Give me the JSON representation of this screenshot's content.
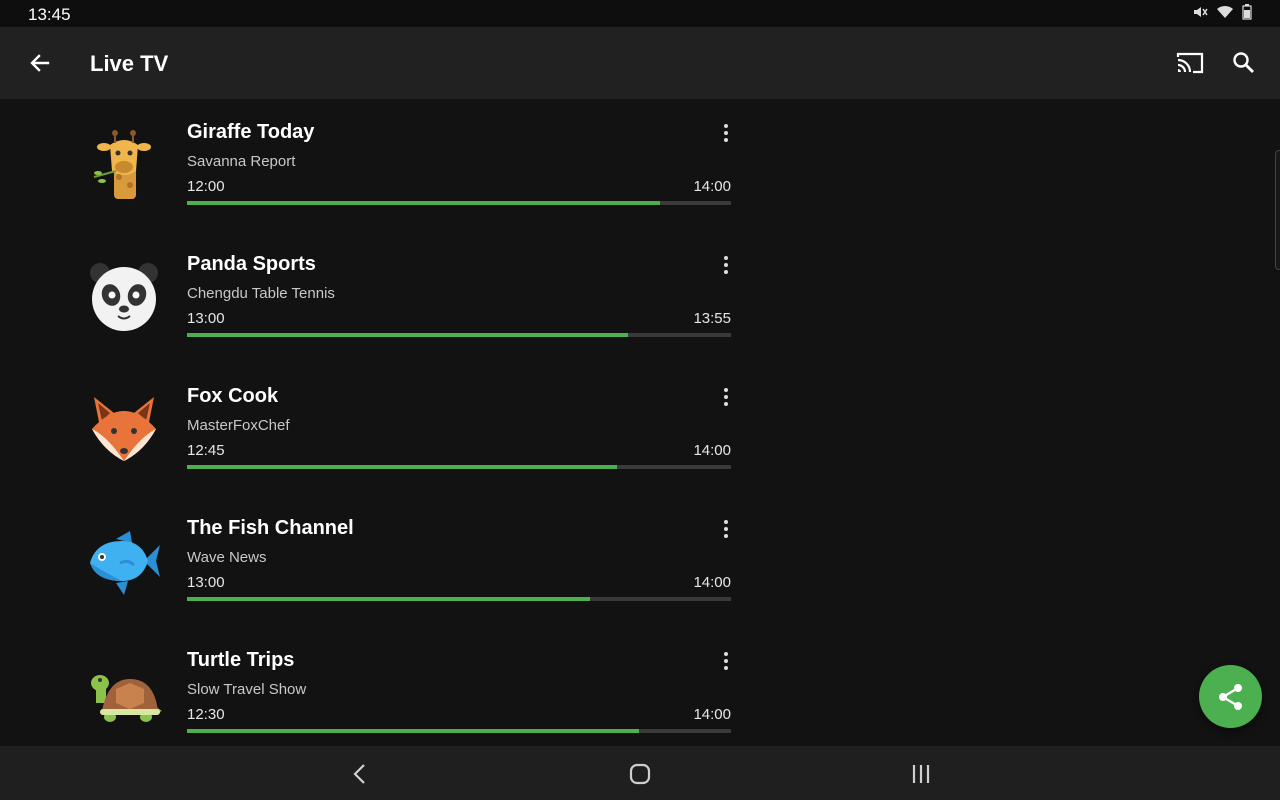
{
  "status_bar": {
    "time": "13:45"
  },
  "app_bar": {
    "title": "Live TV"
  },
  "colors": {
    "accent": "#4caf50",
    "track": "#3a3a3a",
    "appbar": "#212121",
    "background": "#121212"
  },
  "icons": {
    "back": "arrow-back-icon",
    "cast": "cast-icon",
    "search": "search-icon",
    "more": "more-vertical-icon",
    "share": "share-icon"
  },
  "channels": [
    {
      "name": "Giraffe Today",
      "program": "Savanna Report",
      "start": "12:00",
      "end": "14:00",
      "progress": 0.87,
      "logo": "giraffe"
    },
    {
      "name": "Panda Sports",
      "program": "Chengdu Table Tennis",
      "start": "13:00",
      "end": "13:55",
      "progress": 0.81,
      "logo": "panda"
    },
    {
      "name": "Fox Cook",
      "program": "MasterFoxChef",
      "start": "12:45",
      "end": "14:00",
      "progress": 0.79,
      "logo": "fox"
    },
    {
      "name": "The Fish Channel",
      "program": "Wave News",
      "start": "13:00",
      "end": "14:00",
      "progress": 0.74,
      "logo": "fish"
    },
    {
      "name": "Turtle Trips",
      "program": "Slow Travel Show",
      "start": "12:30",
      "end": "14:00",
      "progress": 0.83,
      "logo": "turtle"
    }
  ]
}
